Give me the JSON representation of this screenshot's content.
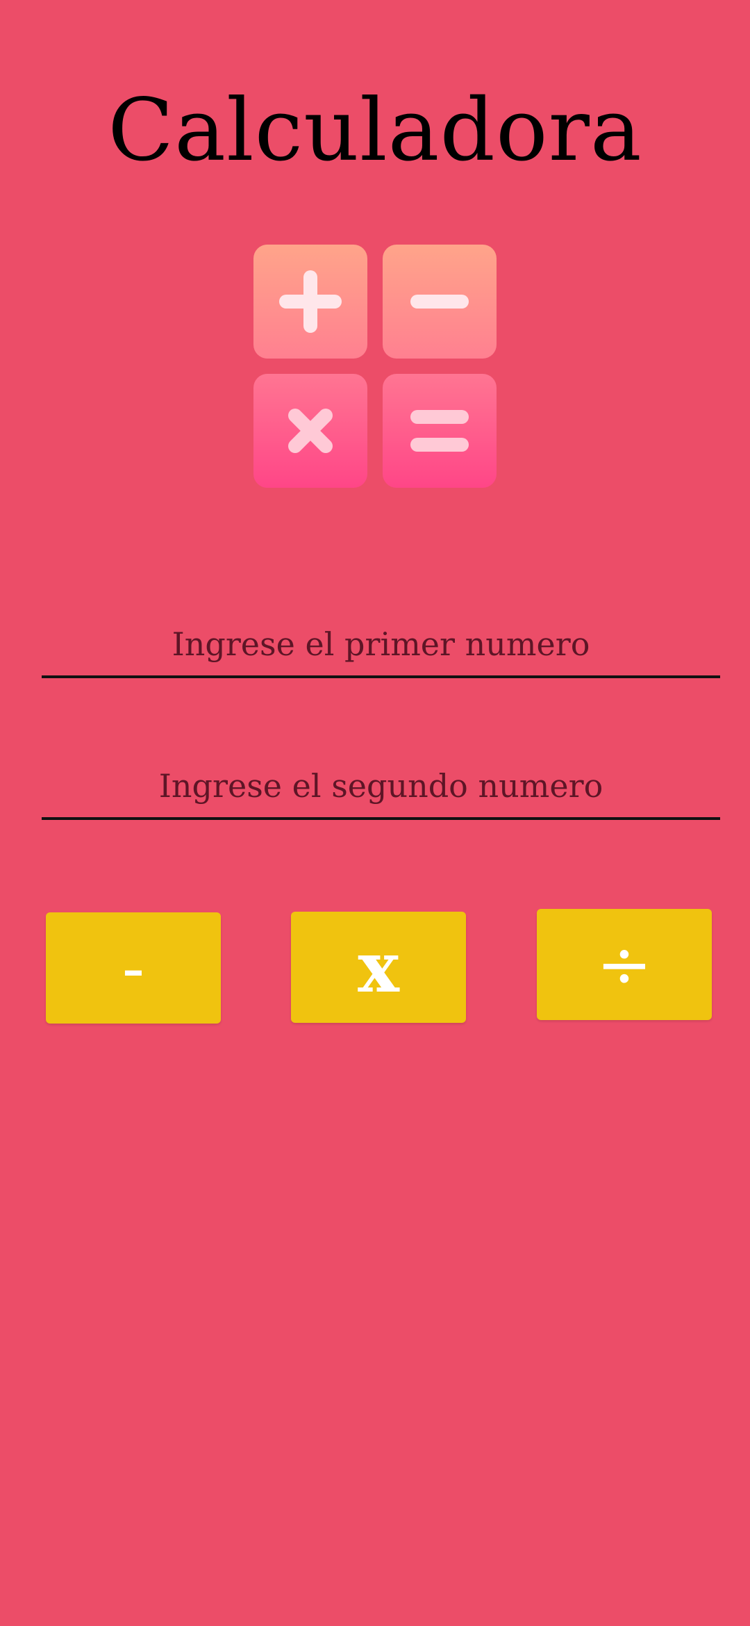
{
  "app": {
    "title": "Calculadora"
  },
  "logo": {
    "tiles": [
      "plus-icon",
      "minus-icon",
      "times-icon",
      "equals-icon"
    ]
  },
  "inputs": {
    "first": {
      "value": "",
      "placeholder": "Ingrese el primer numero"
    },
    "second": {
      "value": "",
      "placeholder": "Ingrese el segundo numero"
    }
  },
  "buttons": {
    "subtract": "-",
    "multiply": "x",
    "divide": "÷"
  },
  "colors": {
    "background": "#EC4D68",
    "button": "#F0C30F",
    "button_text": "#FFFFFF",
    "underline": "#111111"
  }
}
